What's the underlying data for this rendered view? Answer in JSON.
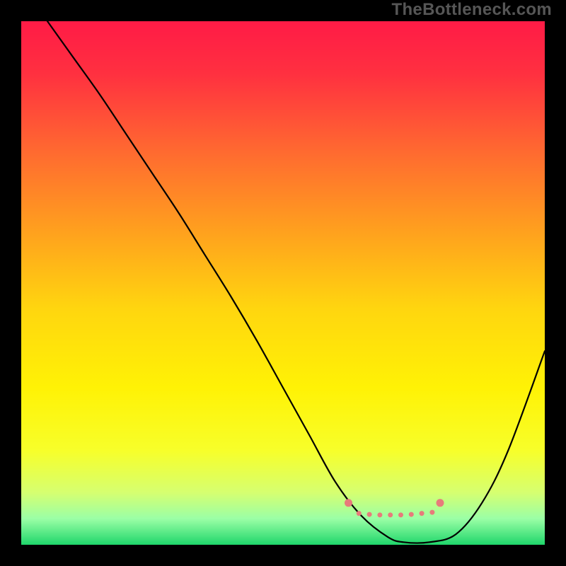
{
  "watermark": "TheBottleneck.com",
  "chart_data": {
    "type": "line",
    "title": "",
    "xlabel": "",
    "ylabel": "",
    "xlim": [
      0,
      100
    ],
    "ylim": [
      0,
      100
    ],
    "grid": false,
    "legend": false,
    "background_gradient": {
      "stops": [
        {
          "offset": 0.0,
          "color": "#ff1b46"
        },
        {
          "offset": 0.1,
          "color": "#ff3040"
        },
        {
          "offset": 0.25,
          "color": "#ff6a30"
        },
        {
          "offset": 0.4,
          "color": "#ffa01e"
        },
        {
          "offset": 0.55,
          "color": "#ffd60f"
        },
        {
          "offset": 0.7,
          "color": "#fff205"
        },
        {
          "offset": 0.82,
          "color": "#f7ff2a"
        },
        {
          "offset": 0.9,
          "color": "#d6ff70"
        },
        {
          "offset": 0.95,
          "color": "#9bffa6"
        },
        {
          "offset": 1.0,
          "color": "#1fd66b"
        }
      ]
    },
    "series": [
      {
        "name": "bottleneck-curve",
        "color": "#000000",
        "width": 2.2,
        "x": [
          5,
          10,
          15,
          20,
          25,
          30,
          35,
          40,
          45,
          50,
          55,
          60,
          65,
          70,
          73,
          78,
          83,
          88,
          93,
          100
        ],
        "y": [
          100,
          93,
          86,
          78.5,
          71,
          63.5,
          55.5,
          47.5,
          39,
          30,
          21,
          12,
          5.5,
          1.5,
          0.5,
          0.5,
          2,
          8,
          18,
          37
        ]
      }
    ],
    "markers": {
      "name": "highlight-band",
      "color": "#e77b7b",
      "radius_end": 5.5,
      "radius_mid": 3.5,
      "points": [
        {
          "x": 62.5,
          "y": 8.0,
          "r": "end"
        },
        {
          "x": 64.5,
          "y": 6.0,
          "r": "mid"
        },
        {
          "x": 66.5,
          "y": 5.8,
          "r": "mid"
        },
        {
          "x": 68.5,
          "y": 5.7,
          "r": "mid"
        },
        {
          "x": 70.5,
          "y": 5.7,
          "r": "mid"
        },
        {
          "x": 72.5,
          "y": 5.7,
          "r": "mid"
        },
        {
          "x": 74.5,
          "y": 5.8,
          "r": "mid"
        },
        {
          "x": 76.5,
          "y": 6.0,
          "r": "mid"
        },
        {
          "x": 78.5,
          "y": 6.2,
          "r": "mid"
        },
        {
          "x": 80.0,
          "y": 8.0,
          "r": "end"
        }
      ]
    }
  }
}
